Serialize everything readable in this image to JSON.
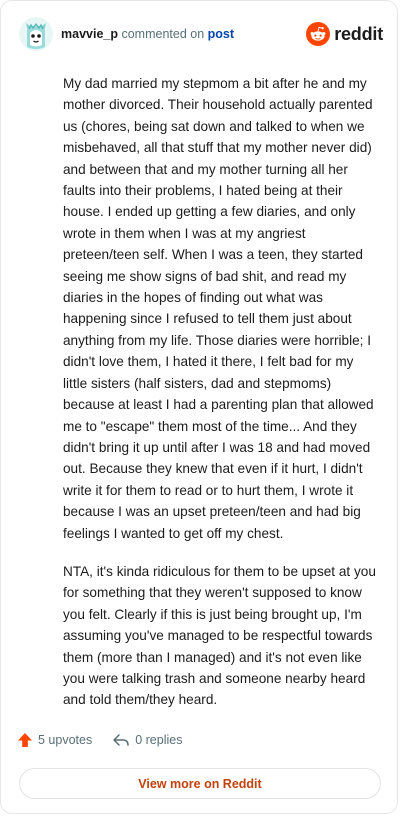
{
  "comment": {
    "author": "mavvie_p",
    "action_text": "commented on",
    "post_link": "post",
    "paragraphs": [
      "My dad married my stepmom a bit after he and my mother divorced. Their household actually parented us (chores, being sat down and talked to when we misbehaved, all that stuff that my mother never did) and between that and my mother turning all her faults into their problems, I hated being at their house. I ended up getting a few diaries, and only wrote in them when I was at my angriest preteen/teen self. When I was a teen, they started seeing me show signs of bad shit, and read my diaries in the hopes of finding out what was happening since I refused to tell them just about anything from my life. Those diaries were horrible; I didn't love them, I hated it there, I felt bad for my little sisters (half sisters, dad and stepmoms) because at least I had a parenting plan that allowed me to \"escape\" them most of the time... And they didn't bring it up until after I was 18 and had moved out. Because they knew that even if it hurt, I didn't write it for them to read or to hurt them, I wrote it because I was an upset preteen/teen and had big feelings I wanted to get off my chest.",
      "NTA, it's kinda ridiculous for them to be upset at you for something that they weren't supposed to know you felt. Clearly if this is just being brought up, I'm assuming you've managed to be respectful towards them (more than I managed) and it's not even like you were talking trash and someone nearby heard and told them/they heard."
    ],
    "upvotes_label": "5 upvotes",
    "replies_label": "0 replies"
  },
  "brand": {
    "name": "reddit",
    "icon": "reddit-logo-icon",
    "color": "#ff4500"
  },
  "footer": {
    "view_more_label": "View more on Reddit"
  },
  "colors": {
    "upvote": "#ff4500",
    "link": "#0045ac",
    "view_more": "#c2410c",
    "muted": "#576f76"
  }
}
